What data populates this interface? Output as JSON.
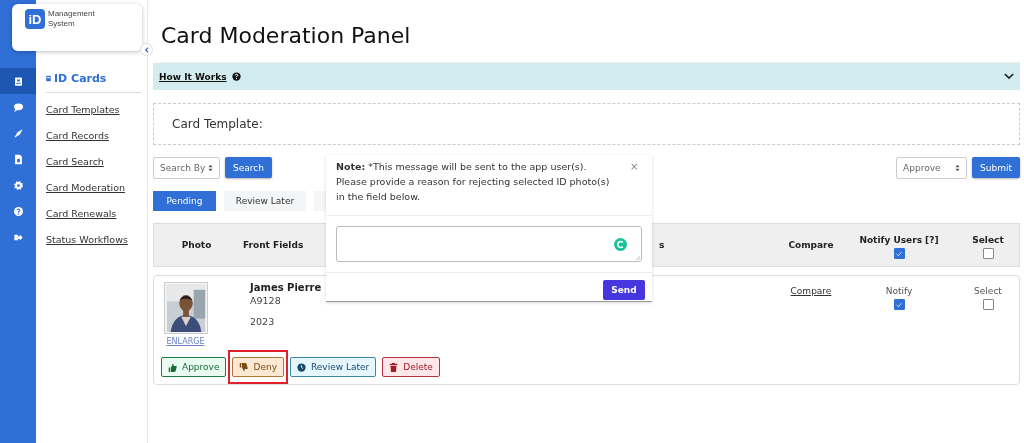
{
  "logo": {
    "mark": "iD",
    "line_1": "Management",
    "line_2": "System"
  },
  "rail": [
    {
      "selected": true
    },
    {
      "selected": false
    },
    {
      "selected": false
    },
    {
      "selected": false
    },
    {
      "selected": false
    },
    {
      "selected": false
    },
    {
      "selected": false
    }
  ],
  "sidebar": {
    "heading": "ID Cards",
    "items": [
      "Card Templates",
      "Card Records",
      "Card Search",
      "Card Moderation",
      "Card Renewals",
      "Status Workflows"
    ]
  },
  "page_title": "Card Moderation Panel",
  "how_it_works": {
    "label": "How It Works",
    "expanded": false
  },
  "card_template_label": "Card Template:",
  "search_by": "Search By",
  "search_button": "Search",
  "bulk_action": "Approve",
  "submit_button": "Submit",
  "tabs": [
    {
      "label": "Pending",
      "selected": true
    },
    {
      "label": "Review Later",
      "selected": false
    }
  ],
  "table": {
    "columns": [
      {
        "label": "Photo"
      },
      {
        "label": "Front Fields"
      },
      {
        "label": "s"
      },
      {
        "label": "Compare"
      },
      {
        "label": "Notify Users [?]",
        "checked": true
      },
      {
        "label": "Select",
        "checked": false
      }
    ],
    "rows": [
      {
        "enlarge": "ENLARGE",
        "name": "James Pierre",
        "id": "A9128",
        "year": "2023",
        "compare": "Compare",
        "notify_label": "Notify",
        "notify": true,
        "select_label": "Select",
        "select": false,
        "actions": [
          {
            "kind": "approve",
            "label": "Approve",
            "highlighted": false
          },
          {
            "kind": "deny",
            "label": "Deny",
            "highlighted": true
          },
          {
            "kind": "review",
            "label": "Review Later",
            "highlighted": false
          },
          {
            "kind": "delete",
            "label": "Delete",
            "highlighted": false
          }
        ]
      }
    ]
  },
  "popup": {
    "note": "**Note:** *This message will be sent to the app user(s). Please provide a reason for rejecting selected ID photo(s) in the field below.",
    "close": "×",
    "send": "Send"
  }
}
